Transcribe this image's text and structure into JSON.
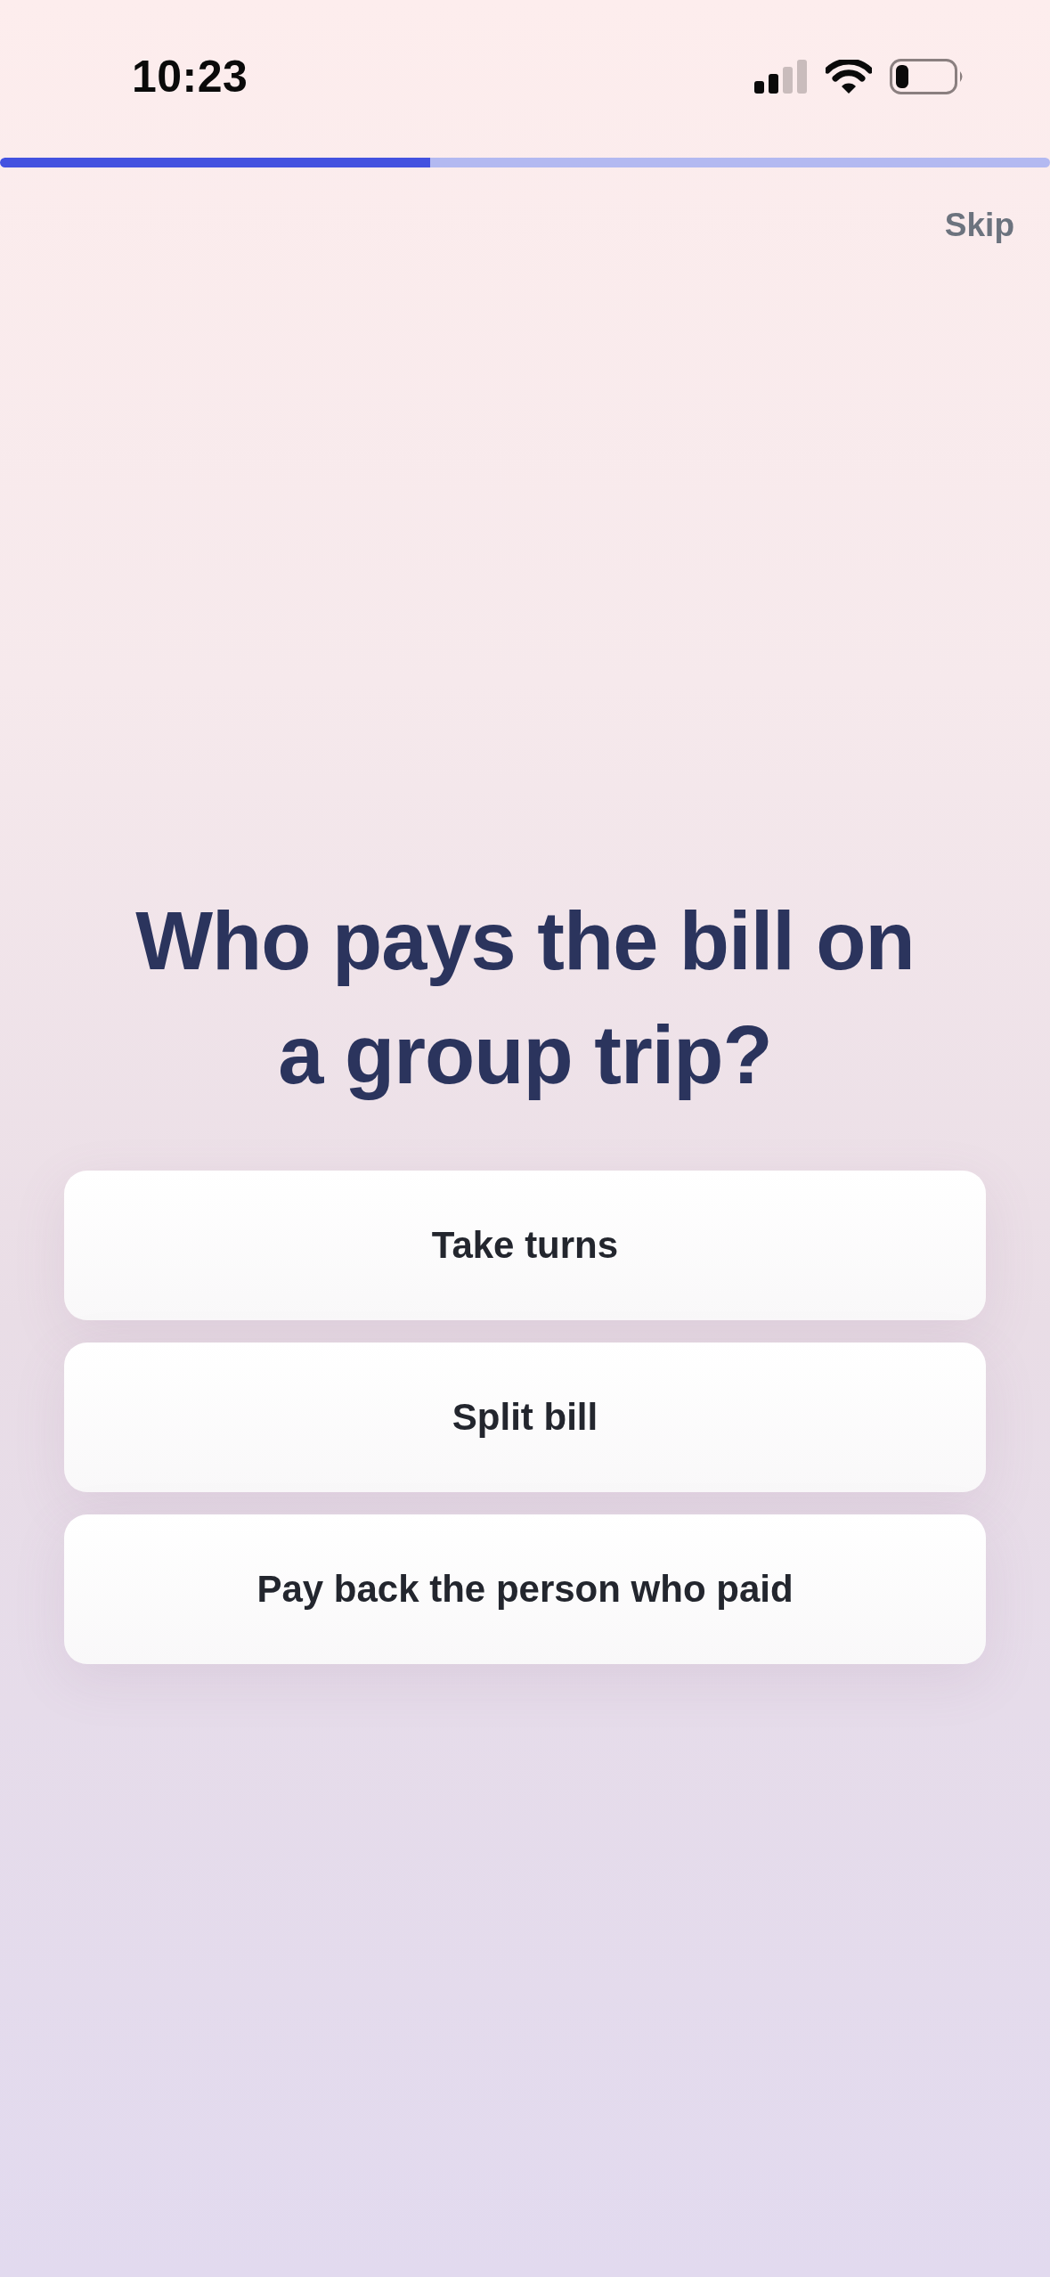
{
  "status_bar": {
    "time": "10:23"
  },
  "progress": {
    "level": 0.41
  },
  "skip": {
    "label": "Skip"
  },
  "question": "Who pays the bill on a group trip?",
  "options": [
    {
      "label": "Take turns"
    },
    {
      "label": "Split bill"
    },
    {
      "label": "Pay back the person who paid"
    }
  ]
}
